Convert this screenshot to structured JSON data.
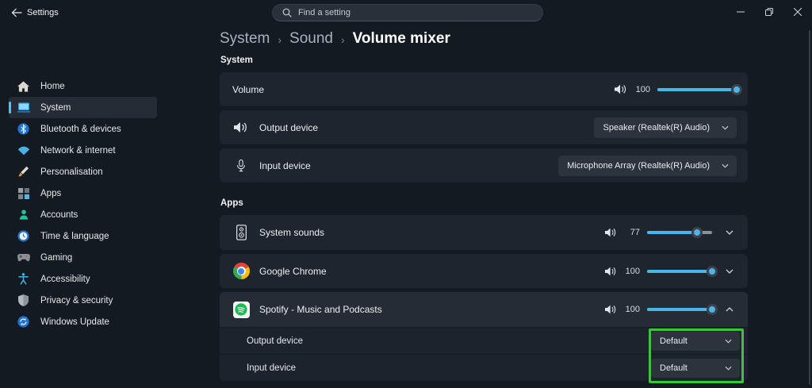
{
  "titlebar": {
    "app_title": "Settings",
    "search_placeholder": "Find a setting",
    "icons": {
      "back": "back-arrow-icon",
      "search": "magnifier-icon",
      "minimize": "minimize-icon",
      "maximize": "restore-icon",
      "close": "close-icon"
    }
  },
  "breadcrumb": {
    "items": [
      "System",
      "Sound",
      "Volume mixer"
    ],
    "separator": "›"
  },
  "sidebar": {
    "items": [
      {
        "label": "Home",
        "icon": "home-icon",
        "selected": false
      },
      {
        "label": "System",
        "icon": "system-icon",
        "selected": true
      },
      {
        "label": "Bluetooth & devices",
        "icon": "bluetooth-icon",
        "selected": false
      },
      {
        "label": "Network & internet",
        "icon": "wifi-icon",
        "selected": false
      },
      {
        "label": "Personalisation",
        "icon": "brush-icon",
        "selected": false
      },
      {
        "label": "Apps",
        "icon": "apps-grid-icon",
        "selected": false
      },
      {
        "label": "Accounts",
        "icon": "person-icon",
        "selected": false
      },
      {
        "label": "Time & language",
        "icon": "clock-icon",
        "selected": false
      },
      {
        "label": "Gaming",
        "icon": "gamepad-icon",
        "selected": false
      },
      {
        "label": "Accessibility",
        "icon": "accessibility-icon",
        "selected": false
      },
      {
        "label": "Privacy & security",
        "icon": "shield-icon",
        "selected": false
      },
      {
        "label": "Windows Update",
        "icon": "update-icon",
        "selected": false
      }
    ]
  },
  "system_section": {
    "header": "System",
    "volume": {
      "label": "Volume",
      "value": 100
    },
    "output": {
      "label": "Output device",
      "selected_option": "Speaker (Realtek(R) Audio)"
    },
    "input": {
      "label": "Input device",
      "selected_option": "Microphone Array (Realtek(R) Audio)"
    }
  },
  "apps_section": {
    "header": "Apps",
    "rows": [
      {
        "app": "System sounds",
        "volume": 77,
        "expanded": false
      },
      {
        "app": "Google Chrome",
        "volume": 100,
        "expanded": false
      },
      {
        "app": "Spotify - Music and Podcasts",
        "volume": 100,
        "expanded": true
      }
    ],
    "spotify_output": {
      "label": "Output device",
      "selected_option": "Default"
    },
    "spotify_input": {
      "label": "Input device",
      "selected_option": "Default"
    }
  },
  "colors": {
    "accent_blue": "#4cb5e8",
    "annotation_green": "#3cc33e",
    "card_background": "#1e252e",
    "page_background": "#141a21"
  }
}
